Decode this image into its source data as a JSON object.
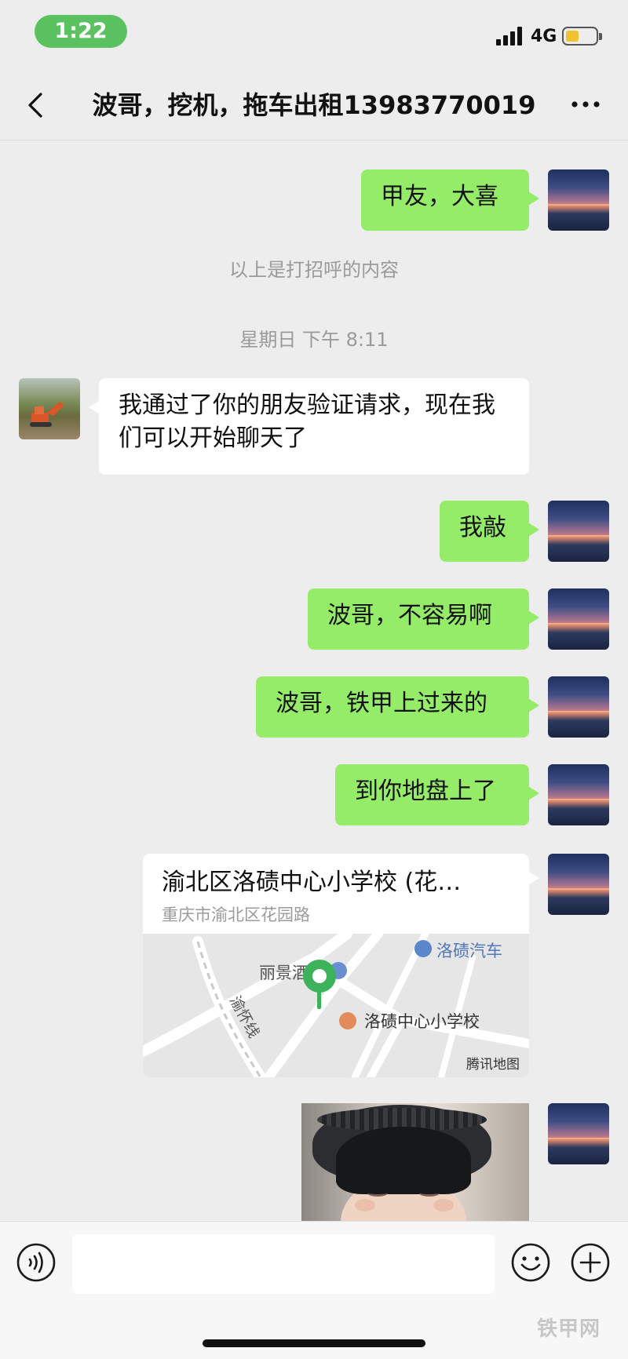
{
  "status_bar": {
    "time": "1:22",
    "network": "4G"
  },
  "nav": {
    "title": "波哥，挖机，拖车出租13983770019"
  },
  "messages": {
    "m1": "甲友，大喜",
    "note_greeting": "以上是打招呼的内容",
    "timestamp": "星期日 下午 8:11",
    "friend_verify": "我通过了你的朋友验证请求，现在我们可以开始聊天了",
    "m2": "我敲",
    "m3": "波哥，不容易啊",
    "m4": "波哥，铁甲上过来的",
    "m5": "到你地盘上了"
  },
  "location": {
    "name": "渝北区洛碛中心小学校 (花…",
    "address": "重庆市渝北区花园路",
    "map_labels": {
      "bus_station": "洛碛汽车",
      "hotel": "丽景酒店",
      "road": "渝怀线",
      "school": "洛碛中心小学校",
      "provider": "腾讯地图"
    }
  },
  "input": {
    "placeholder": ""
  },
  "watermark": "铁甲网",
  "colors": {
    "my_bubble": "#95ec69",
    "background": "#ededed",
    "status_pill": "#5cc161",
    "map_pin": "#3cb25b"
  },
  "icons": [
    "chevron-left-icon",
    "more-icon",
    "voice-icon",
    "emoji-icon",
    "plus-icon",
    "map-pin-icon",
    "bus-icon",
    "school-icon"
  ]
}
